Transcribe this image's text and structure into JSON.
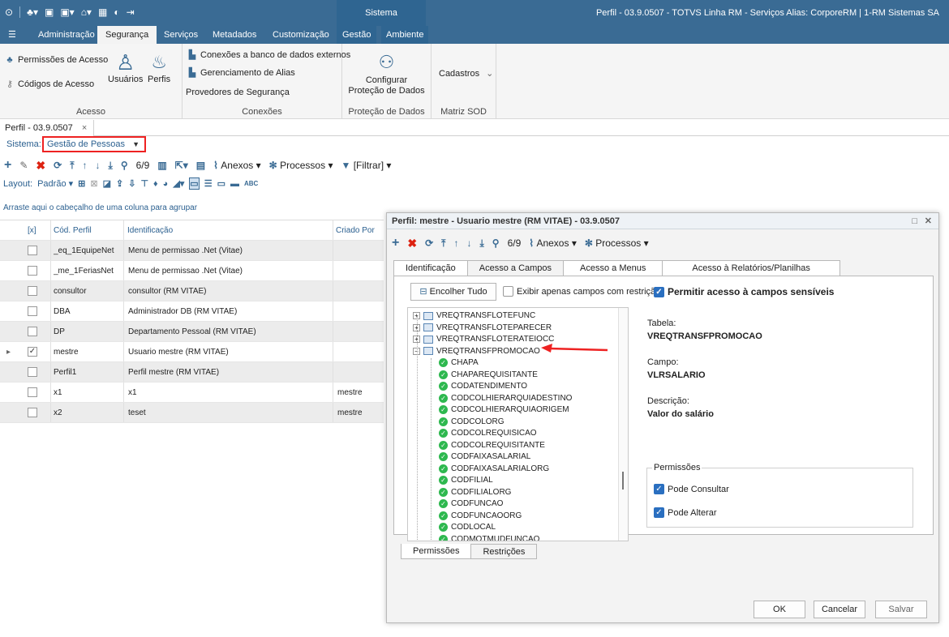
{
  "titlebar": {
    "system_tab": "Sistema",
    "window_title": "Perfil - 03.9.0507 - TOTVS Linha RM - Serviços  Alias: CorporeRM | 1-RM Sistemas SA"
  },
  "menu": {
    "items": [
      "Administração",
      "Segurança",
      "Serviços",
      "Metadados",
      "Customização",
      "Gestão",
      "Ambiente"
    ],
    "active": "Segurança"
  },
  "ribbon": {
    "acesso": {
      "permissoes": "Permissões de Acesso",
      "codigos": "Códigos de Acesso",
      "usuarios": "Usuários",
      "perfis": "Perfis",
      "label": "Acesso"
    },
    "conexoes": {
      "bancos": "Conexões a banco de dados externos",
      "alias": "Gerenciamento de Alias",
      "provedores": "Provedores de Segurança",
      "label": "Conexões"
    },
    "protecao": {
      "configurar_l1": "Configurar",
      "configurar_l2": "Proteção de Dados",
      "label": "Proteção de Dados"
    },
    "matriz": {
      "cadastros": "Cadastros",
      "label": "Matriz SOD"
    }
  },
  "doc_tab": "Perfil - 03.9.0507",
  "sistema": {
    "label": "Sistema:",
    "value": "Gestão de Pessoas"
  },
  "toolbar": {
    "counter": "6/9",
    "anexos": "Anexos",
    "processos": "Processos",
    "filtrar": "[Filtrar]"
  },
  "layout_bar": {
    "label": "Layout:",
    "value": "Padrão"
  },
  "grid": {
    "group_hint": "Arraste aqui o cabeçalho de uma coluna para agrupar",
    "headers": [
      "[x]",
      "Cód. Perfil",
      "Identificação",
      "Criado Por"
    ],
    "rows": [
      {
        "codigo": "_eq_1EquipeNet",
        "identificacao": "Menu de permissao .Net (Vitae)",
        "criado": "",
        "checked": false
      },
      {
        "codigo": "_me_1FeriasNet",
        "identificacao": "Menu de permissao .Net (Vitae)",
        "criado": "",
        "checked": false
      },
      {
        "codigo": "consultor",
        "identificacao": "consultor (RM VITAE)",
        "criado": "",
        "checked": false
      },
      {
        "codigo": "DBA",
        "identificacao": "Administrador DB (RM VITAE)",
        "criado": "",
        "checked": false
      },
      {
        "codigo": "DP",
        "identificacao": "Departamento Pessoal (RM VITAE)",
        "criado": "",
        "checked": false
      },
      {
        "codigo": "mestre",
        "identificacao": "Usuario mestre (RM VITAE)",
        "criado": "",
        "checked": true
      },
      {
        "codigo": "Perfil1",
        "identificacao": "Perfil mestre (RM VITAE)",
        "criado": "",
        "checked": false
      },
      {
        "codigo": "x1",
        "identificacao": "x1",
        "criado": "mestre",
        "checked": false
      },
      {
        "codigo": "x2",
        "identificacao": "teset",
        "criado": "mestre",
        "checked": false
      }
    ]
  },
  "dialog": {
    "title": "Perfil: mestre - Usuario mestre (RM VITAE) - 03.9.0507",
    "counter": "6/9",
    "anexos": "Anexos",
    "processos": "Processos",
    "tabs": [
      "Identificação",
      "Acesso a Campos",
      "Acesso a Menus",
      "Acesso à Relatórios/Planilhas"
    ],
    "active_tab": "Acesso a Campos",
    "collapse_btn": "Encolher Tudo",
    "only_restricted": "Exibir apenas campos com restrição",
    "sensitive": "Permitir acesso à campos sensíveis",
    "tree_tables": [
      "VREQTRANSFLOTEFUNC",
      "VREQTRANSFLOTEPARECER",
      "VREQTRANSFLOTERATEIOCC",
      "VREQTRANSFPROMOCAO"
    ],
    "tree_fields": [
      "CHAPA",
      "CHAPAREQUISITANTE",
      "CODATENDIMENTO",
      "CODCOLHIERARQUIADESTINO",
      "CODCOLHIERARQUIAORIGEM",
      "CODCOLORG",
      "CODCOLREQUISICAO",
      "CODCOLREQUISITANTE",
      "CODFAIXASALARIAL",
      "CODFAIXASALARIALORG",
      "CODFILIAL",
      "CODFILIALORG",
      "CODFUNCAO",
      "CODFUNCAOORG",
      "CODLOCAL",
      "CODMOTMUDFUNCAO"
    ],
    "tabela_label": "Tabela:",
    "tabela_value": "VREQTRANSFPROMOCAO",
    "campo_label": "Campo:",
    "campo_value": "VLRSALARIO",
    "descricao_label": "Descrição:",
    "descricao_value": "Valor do salário",
    "permissoes_label": "Permissões",
    "pode_consultar": "Pode Consultar",
    "pode_alterar": "Pode Alterar",
    "bottom_tabs": [
      "Permissões",
      "Restrições"
    ],
    "ok": "OK",
    "cancelar": "Cancelar",
    "salvar": "Salvar"
  },
  "colors": {
    "brand": "#3a6b94",
    "highlight": "#e22222",
    "check_green": "#2eb84f"
  }
}
